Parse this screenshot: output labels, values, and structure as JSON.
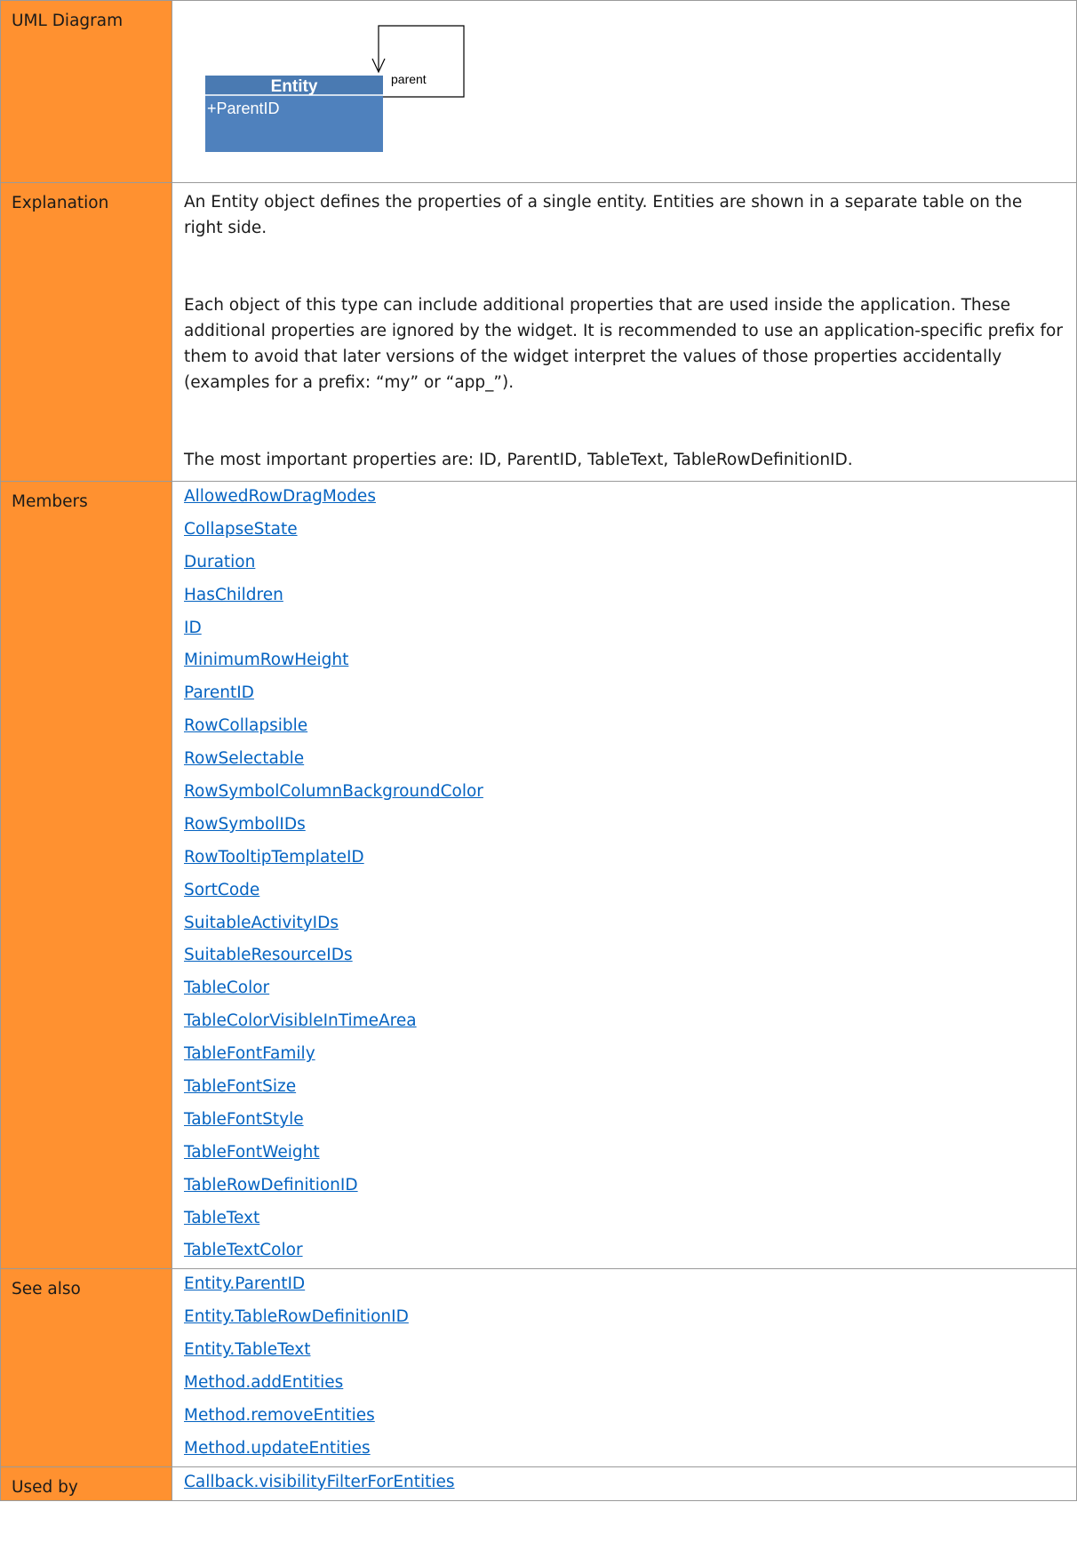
{
  "rows": {
    "uml": {
      "label": "UML Diagram"
    },
    "explanation": {
      "label": "Explanation",
      "paragraphs": [
        "An Entity object defines the properties of a single entity. Entities are shown in a separate table on the right side.",
        "Each object of this type can include additional properties that are used inside the application. These additional properties are ignored by the widget. It is recommended to use an application-specific prefix for them to avoid that later versions of the widget interpret the values of those properties accidentally (examples for a prefix: “my” or “app_”).",
        "The most important properties are: ID, ParentID, TableText, TableRowDefinitionID."
      ]
    },
    "members": {
      "label": "Members",
      "items": [
        "AllowedRowDragModes",
        "CollapseState",
        "Duration",
        "HasChildren",
        "ID",
        "MinimumRowHeight",
        "ParentID",
        "RowCollapsible",
        "RowSelectable",
        "RowSymbolColumnBackgroundColor",
        "RowSymbolIDs",
        "RowTooltipTemplateID",
        "SortCode",
        "SuitableActivityIDs",
        "SuitableResourceIDs",
        "TableColor",
        "TableColorVisibleInTimeArea",
        "TableFontFamily",
        "TableFontSize",
        "TableFontStyle",
        "TableFontWeight",
        "TableRowDefinitionID",
        "TableText",
        "TableTextColor"
      ]
    },
    "see_also": {
      "label": "See also",
      "items": [
        "Entity.ParentID",
        "Entity.TableRowDefinitionID",
        "Entity.TableText",
        "Method.addEntities",
        "Method.removeEntities",
        "Method.updateEntities"
      ]
    },
    "used_by": {
      "label": "Used by",
      "items": [
        "Callback.visibilityFilterForEntities"
      ]
    }
  },
  "uml_diagram": {
    "class_name": "Entity",
    "attribute": "+ParentID",
    "association_label": "parent"
  },
  "colors": {
    "label_background": "#ff9130",
    "uml_class_fill": "#4f81bd",
    "uml_header_fill": "#4a7ab2",
    "link": "#0563c1",
    "border": "#9a9a9a"
  }
}
